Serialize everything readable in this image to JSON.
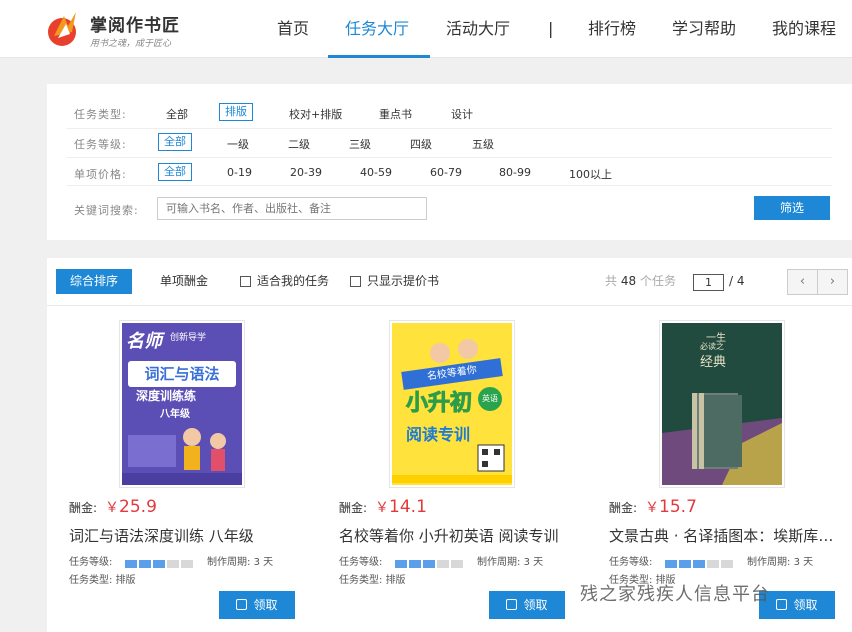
{
  "header": {
    "brand": "掌阅作书匠",
    "slogan": "用书之魂，成于匠心",
    "nav": [
      "首页",
      "任务大厅",
      "活动大厅",
      "|",
      "排行榜",
      "学习帮助",
      "我的课程"
    ],
    "active_index": 1,
    "accent": "#1e88d6"
  },
  "filters": {
    "type_label": "任务类型:",
    "type_options": [
      "全部",
      "排版",
      "校对+排版",
      "重点书",
      "设计"
    ],
    "level_label": "任务等级:",
    "level_options": [
      "全部",
      "一级",
      "二级",
      "三级",
      "四级",
      "五级"
    ],
    "price_label": "单项价格:",
    "price_options": [
      "全部",
      "0-19",
      "20-39",
      "40-59",
      "60-79",
      "80-99",
      "100以上"
    ],
    "keyword_label": "关键词搜索:",
    "keyword_placeholder": "可输入书名、作者、出版社、备注",
    "filter_button": "筛选"
  },
  "toolbar": {
    "sort_default": "综合排序",
    "sort_reward": "单项酬金",
    "check_suitable": "适合我的任务",
    "check_raise": "只显示提价书",
    "total_prefix": "共",
    "total_count": "48",
    "total_suffix": "个任务",
    "current_page": "1",
    "page_total": "/ 4",
    "prev": "‹",
    "next": "›"
  },
  "books": [
    {
      "cover_title_1": "名师",
      "cover_title_2": "创新导学",
      "cover_main": "词汇与语法",
      "cover_sub": "深度训练练",
      "cover_grade": "八年级",
      "reward_label": "酬金:",
      "currency": "￥",
      "price": "25.9",
      "title": "词汇与语法深度训练 八年级",
      "level_label": "任务等级:",
      "level": 3,
      "cycle_label": "制作周期:",
      "cycle": "3 天",
      "type_label": "任务类型:",
      "type": "排版",
      "button": "领取"
    },
    {
      "cover_title_1": "名校等着你",
      "cover_main": "小升初",
      "cover_badge": "英语",
      "cover_sub": "阅读专训",
      "reward_label": "酬金:",
      "currency": "￥",
      "price": "14.1",
      "title": "名校等着你 小升初英语 阅读专训",
      "level_label": "任务等级:",
      "level": 3,
      "cycle_label": "制作周期:",
      "cycle": "3 天",
      "type_label": "任务类型:",
      "type": "排版",
      "button": "领取"
    },
    {
      "cover_title_1": "一生",
      "cover_title_2": "必读之",
      "cover_main": "经典",
      "reward_label": "酬金:",
      "currency": "￥",
      "price": "15.7",
      "title": "文景古典 · 名译插图本：埃斯库罗斯悲剧",
      "level_label": "任务等级:",
      "level": 3,
      "cycle_label": "制作周期:",
      "cycle": "3 天",
      "type_label": "任务类型:",
      "type": "排版",
      "button": "领取"
    }
  ],
  "watermark": "残之家残疾人信息平台"
}
